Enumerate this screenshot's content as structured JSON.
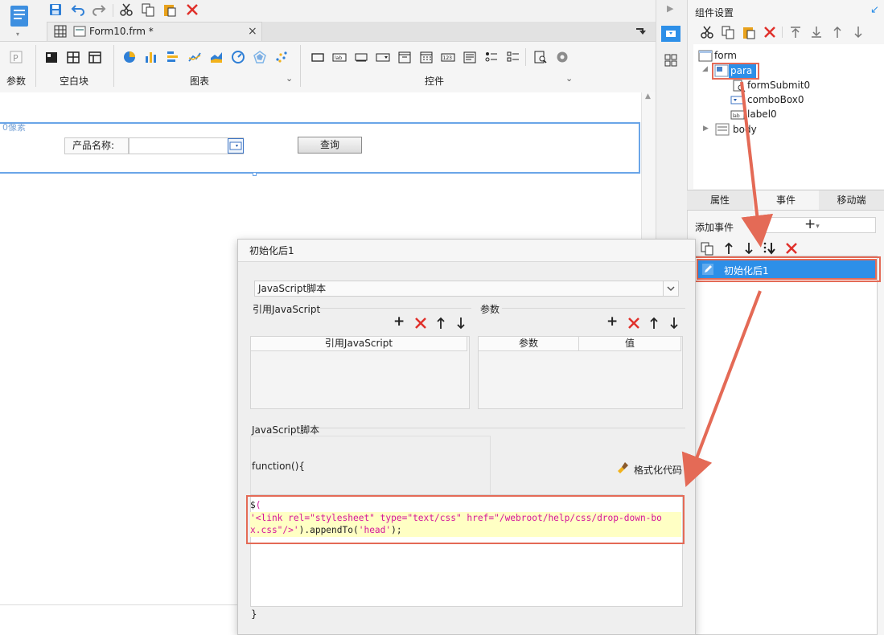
{
  "editor": {
    "tab_title": "Form10.frm *",
    "ribbon_groups": {
      "params": "参数",
      "blank_block": "空白块",
      "charts": "图表",
      "widgets": "控件"
    },
    "ruler_label": "0像素"
  },
  "canvas": {
    "product_label": "产品名称:",
    "combo_value": "",
    "query_button": "查询"
  },
  "panel": {
    "title": "组件设置",
    "tree": {
      "form": "form",
      "para": "para",
      "formSubmit0": "formSubmit0",
      "comboBox0": "comboBox0",
      "label0": "label0",
      "body": "body"
    },
    "tabs": [
      "属性",
      "事件",
      "移动端"
    ],
    "active_tab": "事件",
    "add_event_label": "添加事件",
    "event_item": "初始化后1"
  },
  "dialog": {
    "title": "初始化后1",
    "script_type": "JavaScript脚本",
    "ref_js_section": "引用JavaScript",
    "params_section": "参数",
    "ref_js_column": "引用JavaScript",
    "param_column": "参数",
    "value_column": "值",
    "script_section": "JavaScript脚本",
    "function_open": "function(){",
    "format_code": "格式化代码",
    "code_lines": [
      "$(",
      "'<link rel=\"stylesheet\" type=\"text/css\" href=\"/webroot/help/css/drop-down-bo",
      "x.css\"/>').appendTo('head');"
    ],
    "function_close": "}"
  },
  "colors": {
    "accent": "#2d8fe8",
    "highlight_box": "#e46a56",
    "code_string": "#d4159b"
  }
}
